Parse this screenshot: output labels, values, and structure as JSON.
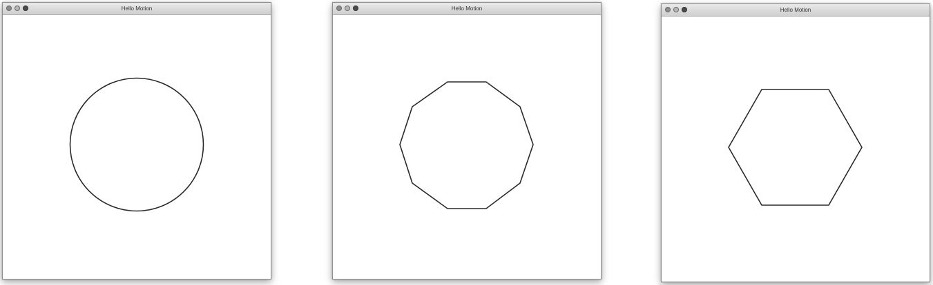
{
  "windows": [
    {
      "title": "Hello Motion",
      "shape": "circle"
    },
    {
      "title": "Hello Motion",
      "shape": "decagon"
    },
    {
      "title": "Hello Motion",
      "shape": "hexagon"
    }
  ],
  "colors": {
    "stroke": "#2a2a2a",
    "canvas": "#ffffff",
    "titlebar": "#dcdcdc"
  }
}
